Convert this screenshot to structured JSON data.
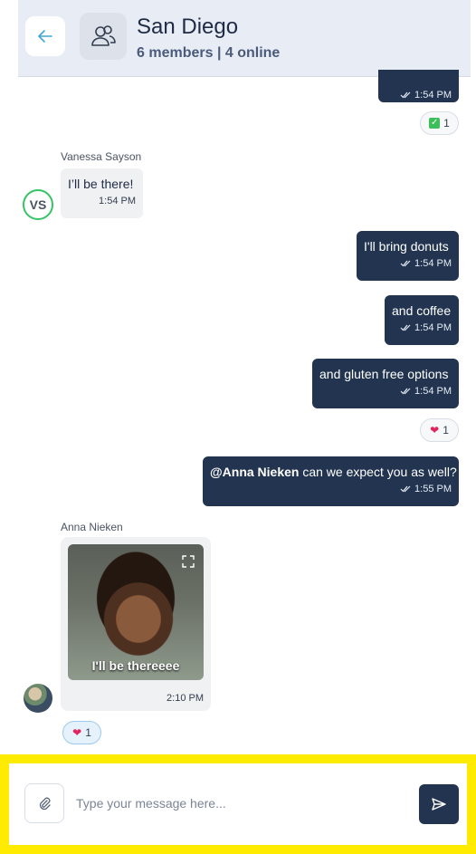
{
  "header": {
    "title": "San Diego",
    "subtitle": "6 members | 4 online"
  },
  "messages": {
    "m0": {
      "time": "1:54 PM"
    },
    "r0": {
      "count": "1"
    },
    "vs": {
      "sender": "Vanessa Sayson",
      "initials": "VS",
      "text": "I’ll be there!",
      "time": "1:54 PM"
    },
    "m1": {
      "text": "I'll bring donuts",
      "time": "1:54 PM"
    },
    "m2": {
      "text": "and coffee",
      "time": "1:54 PM"
    },
    "m3": {
      "text": "and gluten free options",
      "time": "1:54 PM"
    },
    "r1": {
      "count": "1"
    },
    "m4": {
      "mention": "@Anna Nieken",
      "text": " can we expect you as well?",
      "time": "1:55 PM"
    },
    "anna": {
      "sender": "Anna Nieken",
      "gif_caption": "I'll be thereeee",
      "time": "2:10 PM"
    },
    "r2": {
      "count": "1"
    }
  },
  "composer": {
    "placeholder": "Type your message here..."
  },
  "colors": {
    "bubble_out": "#22344f",
    "bubble_in": "#f0f1f3",
    "highlight": "#ffeb00",
    "online_ring": "#34c466"
  }
}
